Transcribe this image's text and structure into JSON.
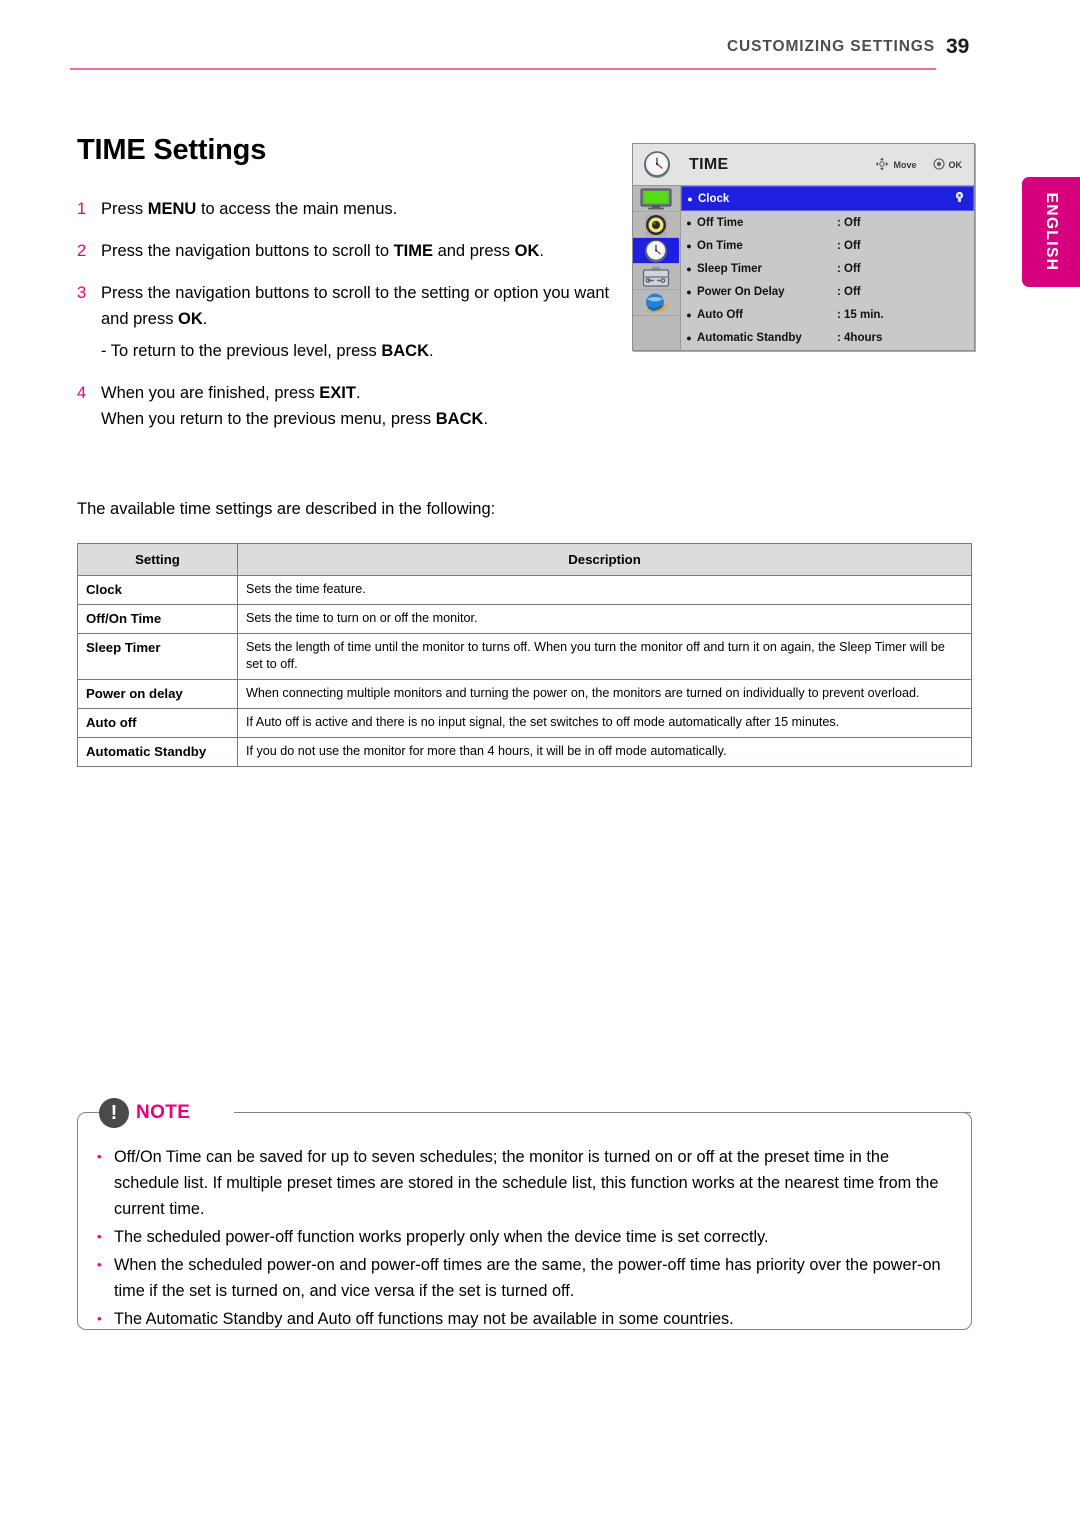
{
  "header": {
    "section_title": "CUSTOMIZING SETTINGS",
    "page_number": "39"
  },
  "language_tab": {
    "label": "ENGLISH"
  },
  "page_title": "TIME Settings",
  "steps": [
    {
      "num": "1",
      "text_parts": [
        "Press ",
        "MENU",
        " to access the main menus."
      ],
      "plain": "Press MENU to access the main menus."
    },
    {
      "num": "2",
      "plain": "Press the navigation buttons to scroll to TIME and press OK."
    },
    {
      "num": "3",
      "plain": "Press the navigation buttons to scroll to the setting or option you want and press OK.",
      "sub": "- To return to the previous level, press BACK."
    },
    {
      "num": "4",
      "plain": "When you are finished, press EXIT.",
      "sub": "When you return to the previous menu, press BACK."
    }
  ],
  "osd": {
    "title": "TIME",
    "hint_move": "Move",
    "hint_ok": "OK",
    "header_icon": "clock-icon",
    "sidebar_icons": [
      "picture-monitor-icon",
      "audio-speaker-icon",
      "clock-icon",
      "toolbox-options-icon",
      "network-globe-icon"
    ],
    "selected_sidebar_index": 2,
    "rows": [
      {
        "label": "Clock",
        "value": "",
        "selected": true
      },
      {
        "label": "Off Time",
        "value": ": Off",
        "selected": false
      },
      {
        "label": "On Time",
        "value": ": Off",
        "selected": false
      },
      {
        "label": "Sleep Timer",
        "value": ": Off",
        "selected": false
      },
      {
        "label": "Power On Delay",
        "value": ": Off",
        "selected": false
      },
      {
        "label": "Auto Off",
        "value": ": 15 min.",
        "selected": false
      },
      {
        "label": "Automatic Standby",
        "value": ": 4hours",
        "selected": false
      }
    ]
  },
  "intro": "The available time settings are described in the following:",
  "table": {
    "headers": [
      "Setting",
      "Description"
    ],
    "rows": [
      {
        "setting": "Clock",
        "description": "Sets the time feature."
      },
      {
        "setting": "Off/On Time",
        "description": "Sets the time to turn on or off the monitor."
      },
      {
        "setting": "Sleep Timer",
        "description": "Sets the length of time until the monitor to turns off. When you turn the monitor off and turn it on again, the Sleep Timer will be set to off."
      },
      {
        "setting": "Power on delay",
        "description": "When connecting multiple monitors and turning the power on, the monitors are turned on individually to prevent overload."
      },
      {
        "setting": "Auto off",
        "description": "If Auto off is active and there is no input signal, the set switches to off mode automatically after 15 minutes."
      },
      {
        "setting": "Automatic Standby",
        "description": "If you do not use the monitor for more than 4 hours, it will be in off mode automatically."
      }
    ]
  },
  "note": {
    "label": "NOTE",
    "items": [
      "Off/On Time can be saved for up to seven schedules; the monitor is turned on or off at the preset time in the schedule list. If multiple preset times are stored in the schedule list, this function works at the nearest time from the current time.",
      "The scheduled power-off function works properly only when the device time is set correctly.",
      "When the scheduled power-on and power-off times are the same, the power-off time has priority over the power-on time if the set is turned on, and vice versa if the set is turned off.",
      "The Automatic Standby and Auto off functions may not be available in some countries."
    ]
  },
  "colors": {
    "accent_pink": "#e5007e",
    "rule_pink": "#f06ba8",
    "osd_highlight": "#1f1fe0",
    "tab_magenta": "#d6007f"
  }
}
